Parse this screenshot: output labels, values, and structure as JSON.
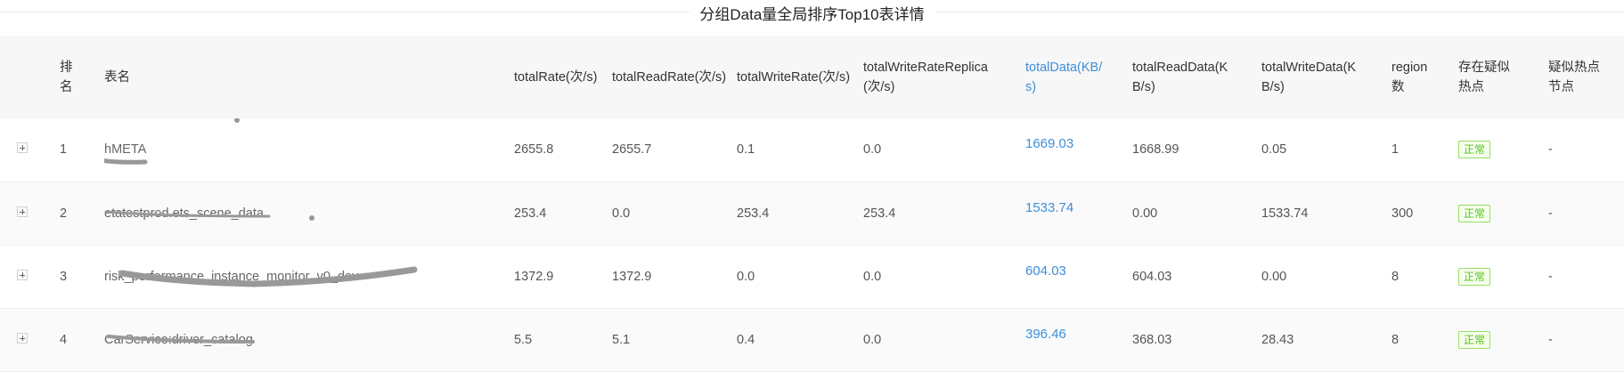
{
  "title": "分组Data量全局排序Top10表详情",
  "columns": [
    "排名",
    "表名",
    "totalRate(次/s)",
    "totalReadRate(次/s)",
    "totalWriteRate(次/s)",
    "totalWriteRateReplica(次/s)",
    "totalData(KB/s)",
    "totalReadData(KB/s)",
    "totalWriteData(KB/s)",
    "region数",
    "存在疑似热点",
    "疑似热点节点"
  ],
  "rows": [
    {
      "rank": "1",
      "name": "hMETA",
      "totalRate": "2655.8",
      "totalReadRate": "2655.7",
      "totalWriteRate": "0.1",
      "totalWriteRateReplica": "0.0",
      "totalData": "1669.03",
      "totalReadData": "1668.99",
      "totalWriteData": "0.05",
      "region": "1",
      "hotspot": "正常",
      "hotnode": "-"
    },
    {
      "rank": "2",
      "name": "etatestprod.ets_scene_data",
      "totalRate": "253.4",
      "totalReadRate": "0.0",
      "totalWriteRate": "253.4",
      "totalWriteRateReplica": "253.4",
      "totalData": "1533.74",
      "totalReadData": "0.00",
      "totalWriteData": "1533.74",
      "region": "300",
      "hotspot": "正常",
      "hotnode": "-"
    },
    {
      "rank": "3",
      "name": "risk_performance_instance_monitor_v0_dev",
      "totalRate": "1372.9",
      "totalReadRate": "1372.9",
      "totalWriteRate": "0.0",
      "totalWriteRateReplica": "0.0",
      "totalData": "604.03",
      "totalReadData": "604.03",
      "totalWriteData": "0.00",
      "region": "8",
      "hotspot": "正常",
      "hotnode": "-"
    },
    {
      "rank": "4",
      "name": "CarService:driver_catalog",
      "totalRate": "5.5",
      "totalReadRate": "5.1",
      "totalWriteRate": "0.4",
      "totalWriteRateReplica": "0.0",
      "totalData": "396.46",
      "totalReadData": "368.03",
      "totalWriteData": "28.43",
      "region": "8",
      "hotspot": "正常",
      "hotnode": "-"
    }
  ]
}
